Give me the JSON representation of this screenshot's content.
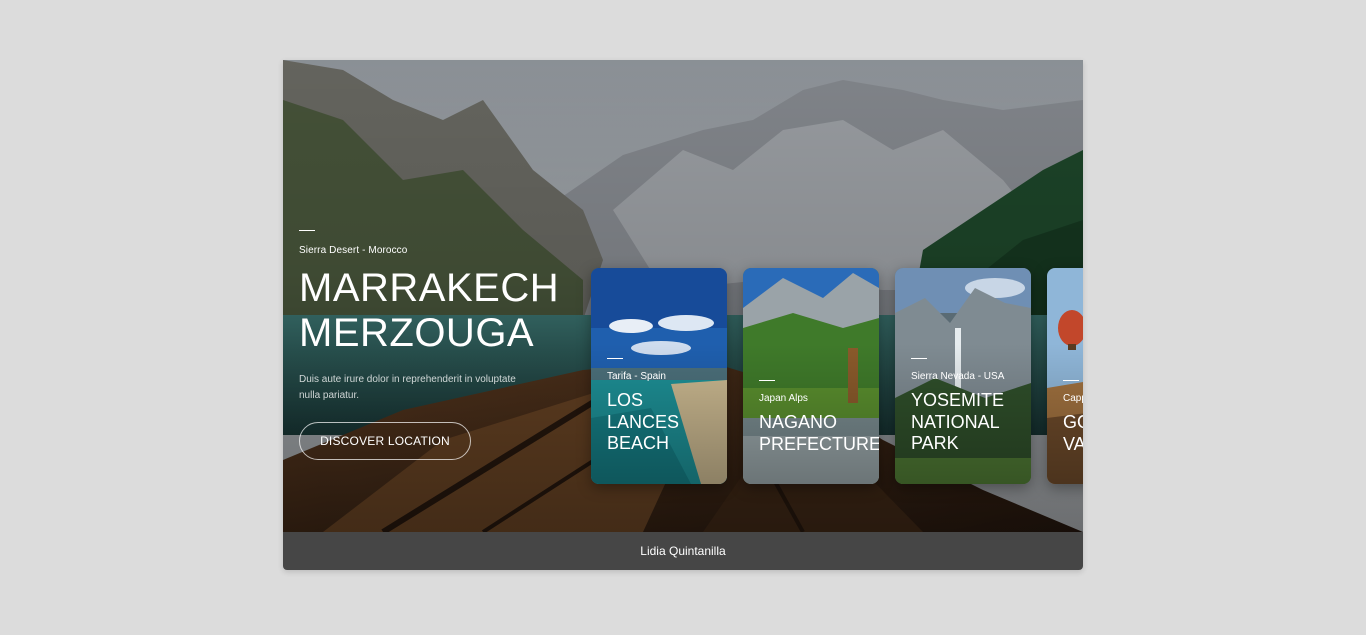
{
  "hero": {
    "location": "Sierra Desert - Morocco",
    "title_line1": "MARRAKECH",
    "title_line2": "MERZOUGA",
    "description": "Duis aute irure dolor in reprehenderit in voluptate nulla pariatur.",
    "button_label": "DISCOVER LOCATION"
  },
  "cards": [
    {
      "location": "Tarifa - Spain",
      "title": "LOS\nLANCES\nBEACH"
    },
    {
      "location": "Japan Alps",
      "title": "NAGANO\nPREFECTURE"
    },
    {
      "location": "Sierra Nevada - USA",
      "title": "YOSEMITE\nNATIONAL\nPARK"
    },
    {
      "location": "Cappadocia",
      "title": "GOREME\nVALLEY"
    }
  ],
  "footer": {
    "author": "Lidia Quintanilla"
  },
  "colors": {
    "page_background": "#dcdcdc",
    "footer_background": "#464646",
    "text": "#ffffff"
  }
}
